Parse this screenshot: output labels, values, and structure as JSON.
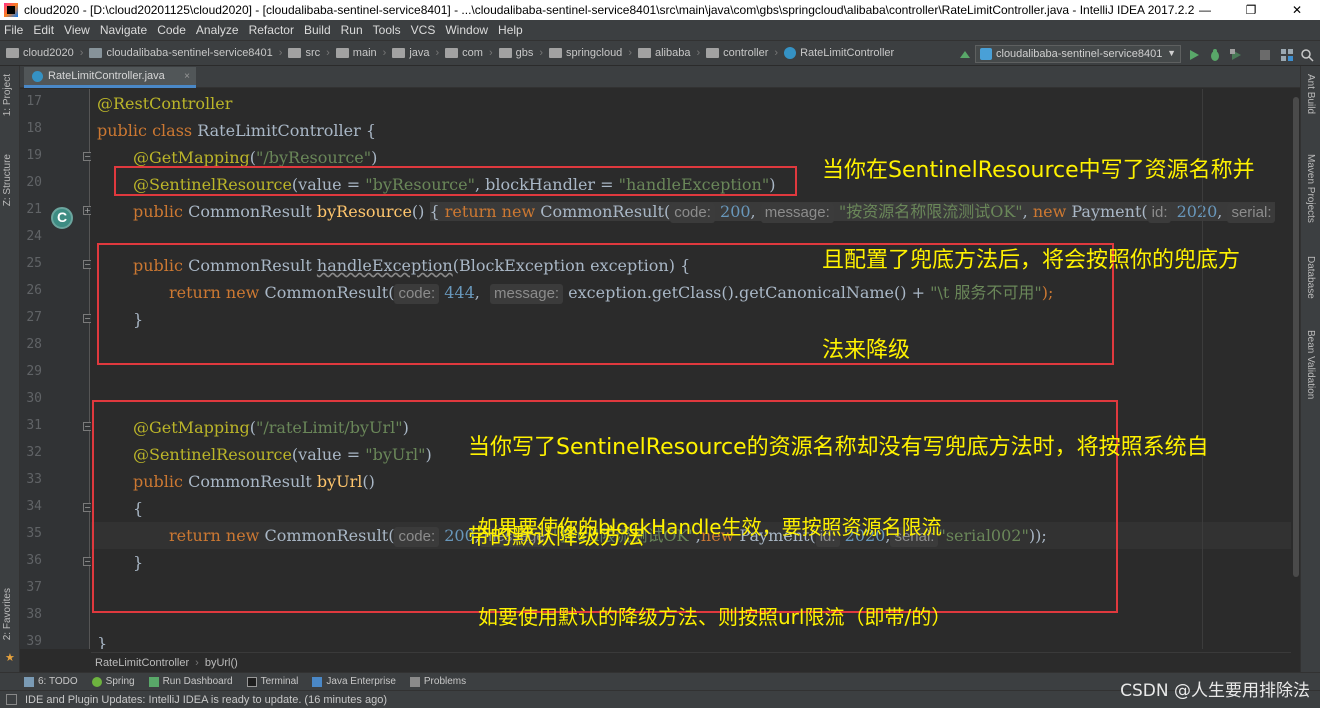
{
  "window": {
    "title": "cloud2020 - [D:\\cloud20201125\\cloud2020] - [cloudalibaba-sentinel-service8401] - ...\\cloudalibaba-sentinel-service8401\\src\\main\\java\\com\\gbs\\springcloud\\alibaba\\controller\\RateLimitController.java - IntelliJ IDEA 2017.2.2",
    "minimize": "—",
    "maximize": "❐",
    "close": "✕"
  },
  "menu": [
    "File",
    "Edit",
    "View",
    "Navigate",
    "Code",
    "Analyze",
    "Refactor",
    "Build",
    "Run",
    "Tools",
    "VCS",
    "Window",
    "Help"
  ],
  "breadcrumbs": [
    "cloud2020",
    "cloudalibaba-sentinel-service8401",
    "src",
    "main",
    "java",
    "com",
    "gbs",
    "springcloud",
    "alibaba",
    "controller",
    "RateLimitController"
  ],
  "run_config": "cloudalibaba-sentinel-service8401",
  "editor_tab": {
    "label": "RateLimitController.java",
    "close": "×"
  },
  "left_tools": [
    "1: Project",
    "Z: Structure",
    "2: Favorites"
  ],
  "right_tools": [
    "Ant Build",
    "Maven Projects",
    "Database",
    "Bean Validation"
  ],
  "line_numbers": [
    "17",
    "18",
    "19",
    "20",
    "21",
    "24",
    "25",
    "26",
    "27",
    "28",
    "29",
    "30",
    "31",
    "32",
    "33",
    "34",
    "35",
    "36",
    "37",
    "38",
    "39"
  ],
  "code": {
    "l17": "@RestController",
    "l18_kw": "public class",
    "l18_name": " RateLimitController {",
    "l19_an": "@GetMapping",
    "l19_a": "(",
    "l19_str": "\"/byResource\"",
    "l19_b": ")",
    "l20_an": "@SentinelResource",
    "l20_a": "(value = ",
    "l20_str1": "\"byResource\"",
    "l20_b": ", blockHandler = ",
    "l20_str2": "\"handleException\"",
    "l20_c": ")",
    "l21_kw": "public",
    "l21_a": " CommonResult ",
    "l21_fn": "byResource",
    "l21_b": "() ",
    "l21_c": "{ ",
    "l21_ret": "return",
    "l21_new": " new",
    "l21_d": " CommonResult",
    "l21_e": "(",
    "l21_hint_code": "code:",
    "l21_num1": " 200",
    "l21_f": ", ",
    "l21_hint_msg": "message:",
    "l21_str": " \"按资源名称限流测试OK\"",
    "l21_g": ", ",
    "l21_new2": "new",
    "l21_h": " Payment",
    "l21_i": "(",
    "l21_hint_id": "id:",
    "l21_num2": " 2020",
    "l21_j": ", ",
    "l21_hint_serial": "serial:",
    "l25_kw": "public",
    "l25_a": " CommonResult ",
    "l25_fn": "handleException",
    "l25_b": "(BlockException exception) {",
    "l26_ret": "return",
    "l26_new": " new",
    "l26_a": " CommonResult",
    "l26_b": "(",
    "l26_hint_code": "code:",
    "l26_num": " 444",
    "l26_c": ",  ",
    "l26_hint_msg": "message:",
    "l26_d": " exception.getClass().getCanonicalName() + ",
    "l26_str": "\"\\t 服务不可用\"",
    "l26_e": ");",
    "l27": "}",
    "l31_an": "@GetMapping",
    "l31_a": "(",
    "l31_str": "\"/rateLimit/byUrl\"",
    "l31_b": ")",
    "l32_an": "@SentinelResource",
    "l32_a": "(value = ",
    "l32_str": "\"byUrl\"",
    "l32_b": ")",
    "l33_kw": "public",
    "l33_a": " CommonResult ",
    "l33_fn": "byUrl",
    "l33_b": "()",
    "l34": "{",
    "l35_ret": "return",
    "l35_new": " new",
    "l35_a": " CommonResult",
    "l35_b": "(",
    "l35_hint_code": "code:",
    "l35_num1": " 200",
    "l35_c": ",",
    "l35_hint_msg": "message:",
    "l35_str1": "\"按url限流测试OK\"",
    "l35_d": ",",
    "l35_new2": "new",
    "l35_e": " Payment",
    "l35_f": "(",
    "l35_hint_id": "id:",
    "l35_num2": " 2020",
    "l35_g": ",",
    "l35_hint_serial": "serial:",
    "l35_str2": "\"serial002\"",
    "l35_h": "));",
    "l36": "}",
    "l39": "}"
  },
  "notes": {
    "note1_l1": "当你在SentinelResource中写了资源名称并",
    "note1_l2": "且配置了兜底方法后，将会按照你的兜底方",
    "note1_l3": "法来降级",
    "note2_l1": "当你写了SentinelResource的资源名称却没有写兜底方法时，将按照系统自",
    "note2_l2": "带的默认降级方法",
    "note3_l1": "如果要使你的blockHandle生效，要按照资源名限流",
    "note3_l2": "如要使用默认的降级方法、则按照url限流（即带/的）"
  },
  "code_breadcrumb": [
    "RateLimitController",
    "byUrl()"
  ],
  "tool_windows": [
    "6: TODO",
    "Spring",
    "Run Dashboard",
    "Terminal",
    "Java Enterprise",
    "Problems"
  ],
  "status": "IDE and Plugin Updates: IntelliJ IDEA is ready to update. (16 minutes ago)",
  "watermark": "CSDN @人生要用排除法",
  "colors": {
    "annotation_text": "#fff200",
    "annotation_box": "#e0393e",
    "editor_bg": "#2b2b2b",
    "keyword": "#cc7832",
    "annotation": "#bbb529",
    "string": "#6a8759",
    "number": "#6897bb",
    "method": "#ffc66d"
  }
}
